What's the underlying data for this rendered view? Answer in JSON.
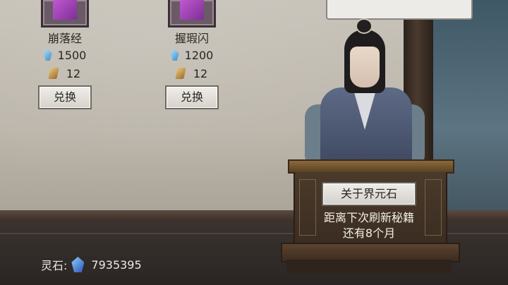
{
  "shop_items": [
    {
      "name": "崩落经",
      "gem_cost": "1500",
      "token_cost": "12",
      "exchange_label": "兑换"
    },
    {
      "name": "握瑕闪",
      "gem_cost": "1200",
      "token_cost": "12",
      "exchange_label": "兑换"
    }
  ],
  "npc_panel": {
    "about_button_label": "关于界元石",
    "refresh_line1": "距离下次刷新秘籍",
    "refresh_line2": "还有8个月"
  },
  "currency": {
    "label": "灵石:",
    "amount": "7935395",
    "icon": "spirit-stone-icon"
  },
  "icons": {
    "gem": "blue-gem-icon",
    "token": "gold-token-icon"
  }
}
